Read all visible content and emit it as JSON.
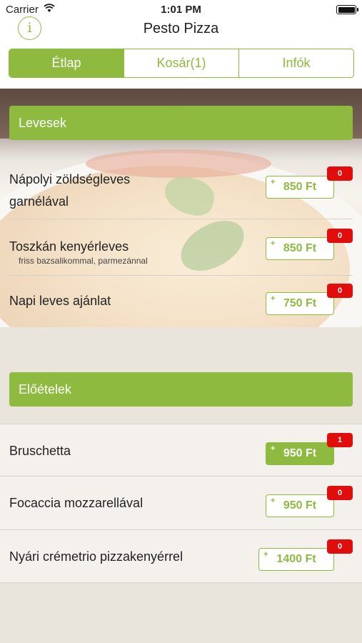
{
  "status_bar": {
    "carrier": "Carrier",
    "time": "1:01 PM"
  },
  "header": {
    "title": "Pesto Pizza",
    "info_symbol": "i"
  },
  "tabs": [
    {
      "label": "Étlap",
      "active": true
    },
    {
      "label": "Kosár(1)",
      "active": false
    },
    {
      "label": "Infók",
      "active": false
    }
  ],
  "sections": [
    {
      "title": "Levesek",
      "items": [
        {
          "name_line1": "Nápolyi zöldségleves",
          "name_line2": "garnélával",
          "price": "850 Ft",
          "count": "0"
        },
        {
          "name": "Toszkán kenyérleves",
          "subtitle": "friss bazsalikommal, parmezánnal",
          "price": "850 Ft",
          "count": "0"
        },
        {
          "name": "Napi leves ajánlat",
          "price": "750 Ft",
          "count": "0"
        }
      ]
    },
    {
      "title": "Előételek",
      "items": [
        {
          "name": "Bruschetta",
          "price": "950 Ft",
          "count": "1",
          "selected": true
        },
        {
          "name": "Focaccia mozzarellával",
          "price": "950 Ft",
          "count": "0"
        },
        {
          "name": "Nyári crémetrio pizzakenyérrel",
          "price": "1400 Ft",
          "count": "0"
        }
      ]
    }
  ],
  "price_plus_symbol": "+",
  "colors": {
    "accent": "#8dba3f",
    "badge": "#e10c0c",
    "background": "#e9e4dc"
  }
}
